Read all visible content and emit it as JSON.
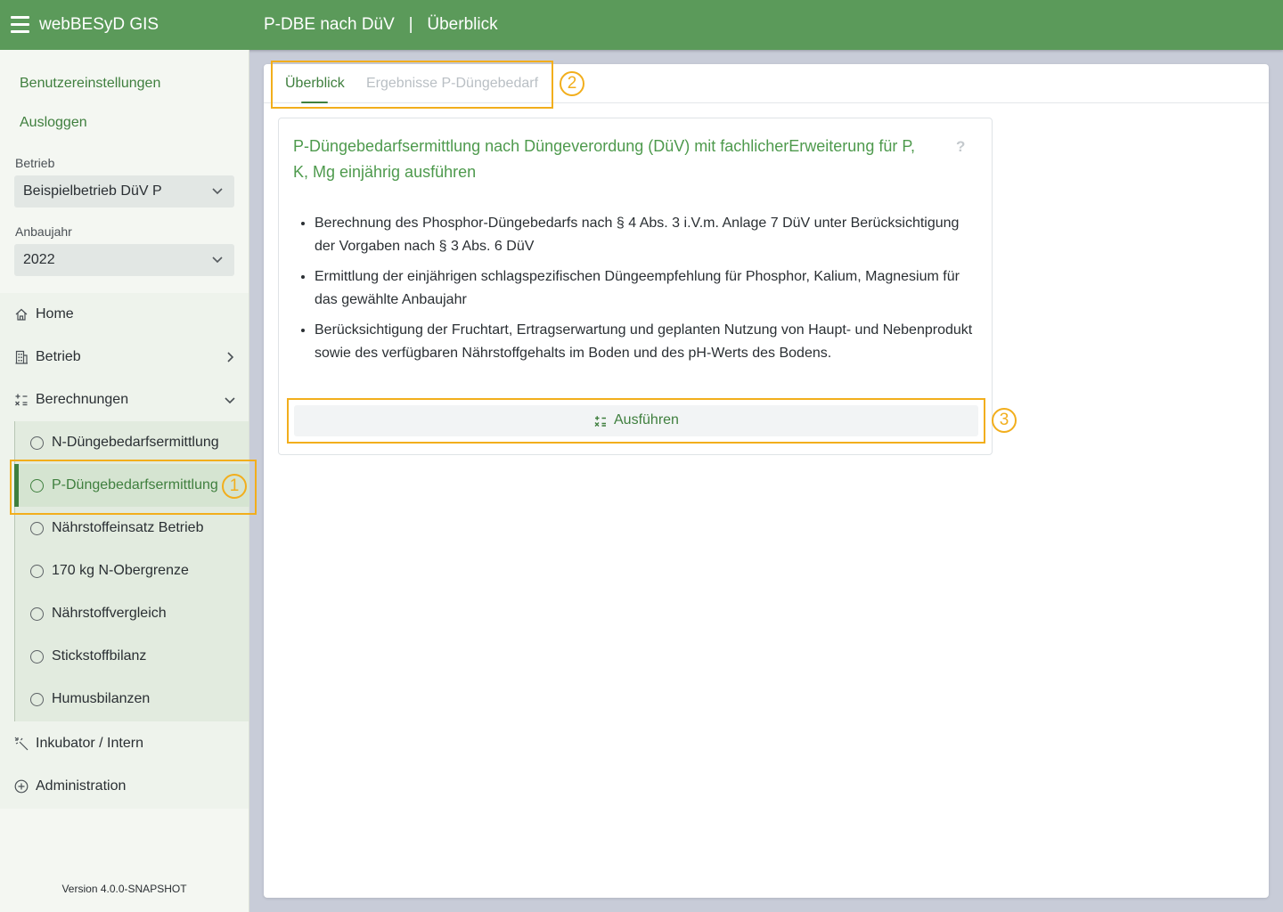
{
  "app": {
    "title": "webBESyD GIS"
  },
  "header": {
    "title": "P-DBE nach DüV   |   Überblick"
  },
  "sidebar": {
    "user_settings": "Benutzereinstellungen",
    "logout": "Ausloggen",
    "betrieb_label": "Betrieb",
    "betrieb_value": "Beispielbetrieb DüV P",
    "anbaujahr_label": "Anbaujahr",
    "anbaujahr_value": "2022",
    "nav": {
      "home": "Home",
      "betrieb": "Betrieb",
      "berechnungen": "Berechnungen",
      "inkubator": "Inkubator / Intern",
      "administration": "Administration"
    },
    "sub": [
      "N-Düngebedarfsermittlung",
      "P-Düngebedarfsermittlung",
      "Nährstoffeinsatz Betrieb",
      "170 kg N-Obergrenze",
      "Nährstoffvergleich",
      "Stickstoffbilanz",
      "Humusbilanzen"
    ],
    "active_sub": "P-Düngebedarfsermittlung",
    "version": "Version 4.0.0-SNAPSHOT"
  },
  "main": {
    "tabs": [
      "Überblick",
      "Ergebnisse P-Düngebedarf"
    ],
    "card": {
      "title": "P-Düngebedarfsermittlung nach Düngeverordung (DüV) mit fachlicherErweiterung für P, K, Mg einjährig ausführen",
      "help": "?",
      "bullets": [
        "Berechnung des Phosphor-Düngebedarfs nach § 4 Abs. 3 i.V.m. Anlage 7 DüV unter Berücksichtigung der Vorgaben nach § 3 Abs. 6 DüV",
        "Ermittlung der einjährigen schlagspezifischen Düngeempfehlung für Phosphor, Kalium, Magnesium für das gewählte Anbaujahr",
        "Berücksichtigung der Fruchtart, Ertragserwartung und geplanten Nutzung von Haupt- und Nebenprodukt sowie des verfügbaren Nährstoffgehalts im Boden und des pH-Werts des Bodens."
      ],
      "run_button": "Ausführen"
    }
  },
  "annotations": [
    "1",
    "2",
    "3"
  ],
  "colors": {
    "header_bg": "#5b9a5a",
    "accent": "#3f7f3e",
    "annotation": "#f2ae1c"
  }
}
